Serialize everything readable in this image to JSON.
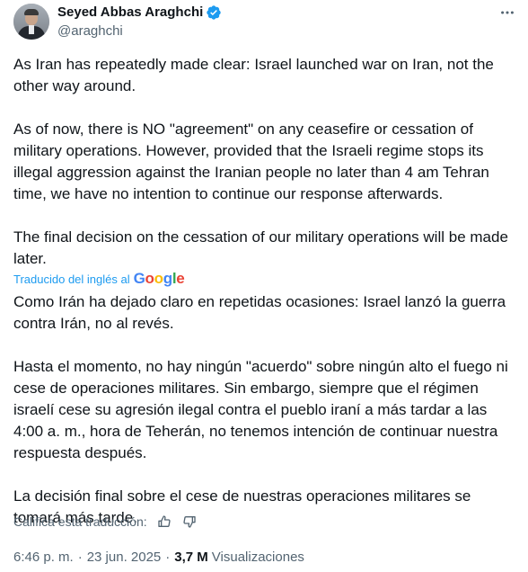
{
  "author": {
    "name": "Seyed Abbas Araghchi",
    "handle": "@araghchi"
  },
  "tweet": {
    "paragraphs": [
      "As Iran has repeatedly made clear: Israel launched war on Iran, not the other way around.",
      "As of now, there is NO \"agreement\" on any ceasefire or cessation of military operations. However, provided that the Israeli regime stops its illegal aggression against the Iranian people no later than 4 am Tehran time, we have no intention to continue our response afterwards.",
      "The final decision on the cessation of our military operations will be made later."
    ]
  },
  "translation_notice": {
    "label": "Traducido del inglés al",
    "google": [
      "G",
      "o",
      "o",
      "g",
      "l",
      "e"
    ]
  },
  "translation": {
    "paragraphs": [
      "Como Irán ha dejado claro en repetidas ocasiones: Israel lanzó la guerra contra Irán, no al revés.",
      "Hasta el momento, no hay ningún \"acuerdo\" sobre ningún alto el fuego ni cese de operaciones militares. Sin embargo, siempre que el régimen israelí cese su agresión ilegal contra el pueblo iraní a más tardar a las 4:00 a. m., hora de Teherán, no tenemos intención de continuar nuestra respuesta después.",
      "La decisión final sobre el cese de nuestras operaciones militares se tomará más tarde."
    ]
  },
  "rate": {
    "label": "Califica esta traducción:"
  },
  "meta": {
    "time": "6:46 p. m.",
    "separator": "·",
    "date": "23 jun. 2025",
    "views_count": "3,7 M",
    "views_label": "Visualizaciones"
  },
  "colors": {
    "verified": "#1d9bf0",
    "link": "#1d9bf0",
    "secondary": "#536471"
  }
}
